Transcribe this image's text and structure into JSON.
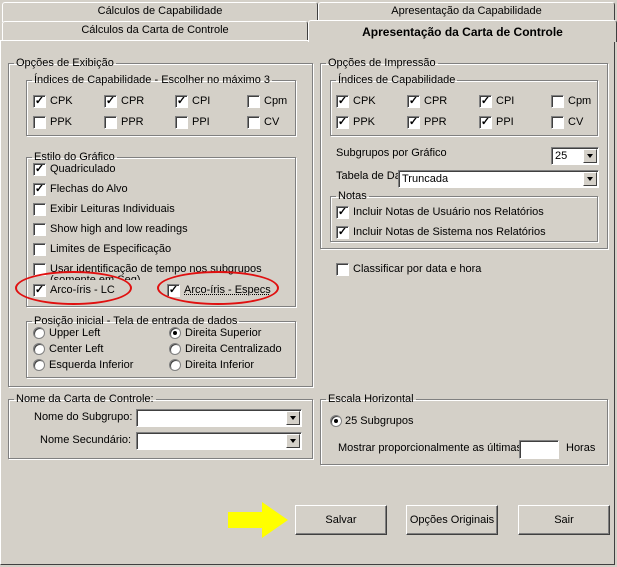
{
  "tabs": {
    "row1": [
      "Cálculos de Capabilidade",
      "Apresentação da Capabilidade"
    ],
    "row2": [
      "Cálculos da Carta de Controle",
      "Apresentação da Carta de Controle"
    ]
  },
  "exibicao": {
    "title": "Opções de Exibição",
    "indices_title": "Índices de Capabilidade - Escolher no máximo 3",
    "indices": [
      {
        "label": "CPK",
        "checked": true
      },
      {
        "label": "CPR",
        "checked": true
      },
      {
        "label": "CPI",
        "checked": true
      },
      {
        "label": "Cpm",
        "checked": false
      },
      {
        "label": "PPK",
        "checked": false
      },
      {
        "label": "PPR",
        "checked": false
      },
      {
        "label": "PPI",
        "checked": false
      },
      {
        "label": "CV",
        "checked": false
      }
    ],
    "estilo_title": "Estilo do Gráfico",
    "estilo": [
      {
        "label": "Quadriculado",
        "checked": true
      },
      {
        "label": "Flechas do Alvo",
        "checked": true
      },
      {
        "label": "Exibir Leituras Individuais",
        "checked": false
      },
      {
        "label": "Show high and low readings",
        "checked": false
      },
      {
        "label": "Limites de Especificação",
        "checked": false
      },
      {
        "label": "Usar identificação de tempo nos subgrupos",
        "label2": "(somente em Seq)",
        "checked": false
      }
    ],
    "arco_lc": {
      "label": "Arco-íris - LC",
      "checked": true
    },
    "arco_esp": {
      "label": "Arco-íris - Especs",
      "checked": true
    },
    "posicao_title": "Posição inicial - Tela de entrada de dados",
    "posicao": [
      {
        "label": "Upper Left",
        "selected": false
      },
      {
        "label": "Direita Superior",
        "selected": true
      },
      {
        "label": "Center Left",
        "selected": false
      },
      {
        "label": "Direita Centralizado",
        "selected": false
      },
      {
        "label": "Esquerda Inferior",
        "selected": false
      },
      {
        "label": "Direita Inferior",
        "selected": false
      }
    ]
  },
  "impressao": {
    "title": "Opções de Impressão",
    "indices_title": "Índices de Capabilidade",
    "indices": [
      {
        "label": "CPK",
        "checked": true
      },
      {
        "label": "CPR",
        "checked": true
      },
      {
        "label": "CPI",
        "checked": true
      },
      {
        "label": "Cpm",
        "checked": false
      },
      {
        "label": "PPK",
        "checked": true
      },
      {
        "label": "PPR",
        "checked": true
      },
      {
        "label": "PPI",
        "checked": true
      },
      {
        "label": "CV",
        "checked": false
      }
    ],
    "subgrupos_label": "Subgrupos por Gráfico",
    "subgrupos_value": "25",
    "tabela_label": "Tabela de Da",
    "tabela_value": "Truncada",
    "notas_title": "Notas",
    "notas": [
      {
        "label": "Incluir Notas de Usuário nos Relatórios",
        "checked": true
      },
      {
        "label": "Incluir Notas de Sistema nos Relatórios",
        "checked": true
      }
    ],
    "classificar": {
      "label": "Classificar por data e hora",
      "checked": false
    }
  },
  "nome": {
    "title": "Nome da Carta de Controle:",
    "subgrupo_label": "Nome do Subgrupo:",
    "subgrupo_value": "",
    "secundario_label": "Nome Secundário:",
    "secundario_value": ""
  },
  "escala": {
    "title": "Escala Horizontal",
    "opt1": "25 Subgrupos",
    "opt2": "Mostrar proporcionalmente as últimas:",
    "opt2_value": "",
    "hours": "Horas"
  },
  "buttons": {
    "save": "Salvar",
    "original": "Opções Originais",
    "exit": "Sair"
  },
  "colors": {
    "bg": "#d4d0c8",
    "highlight": "#e01010",
    "arrow": "#ffff00"
  }
}
